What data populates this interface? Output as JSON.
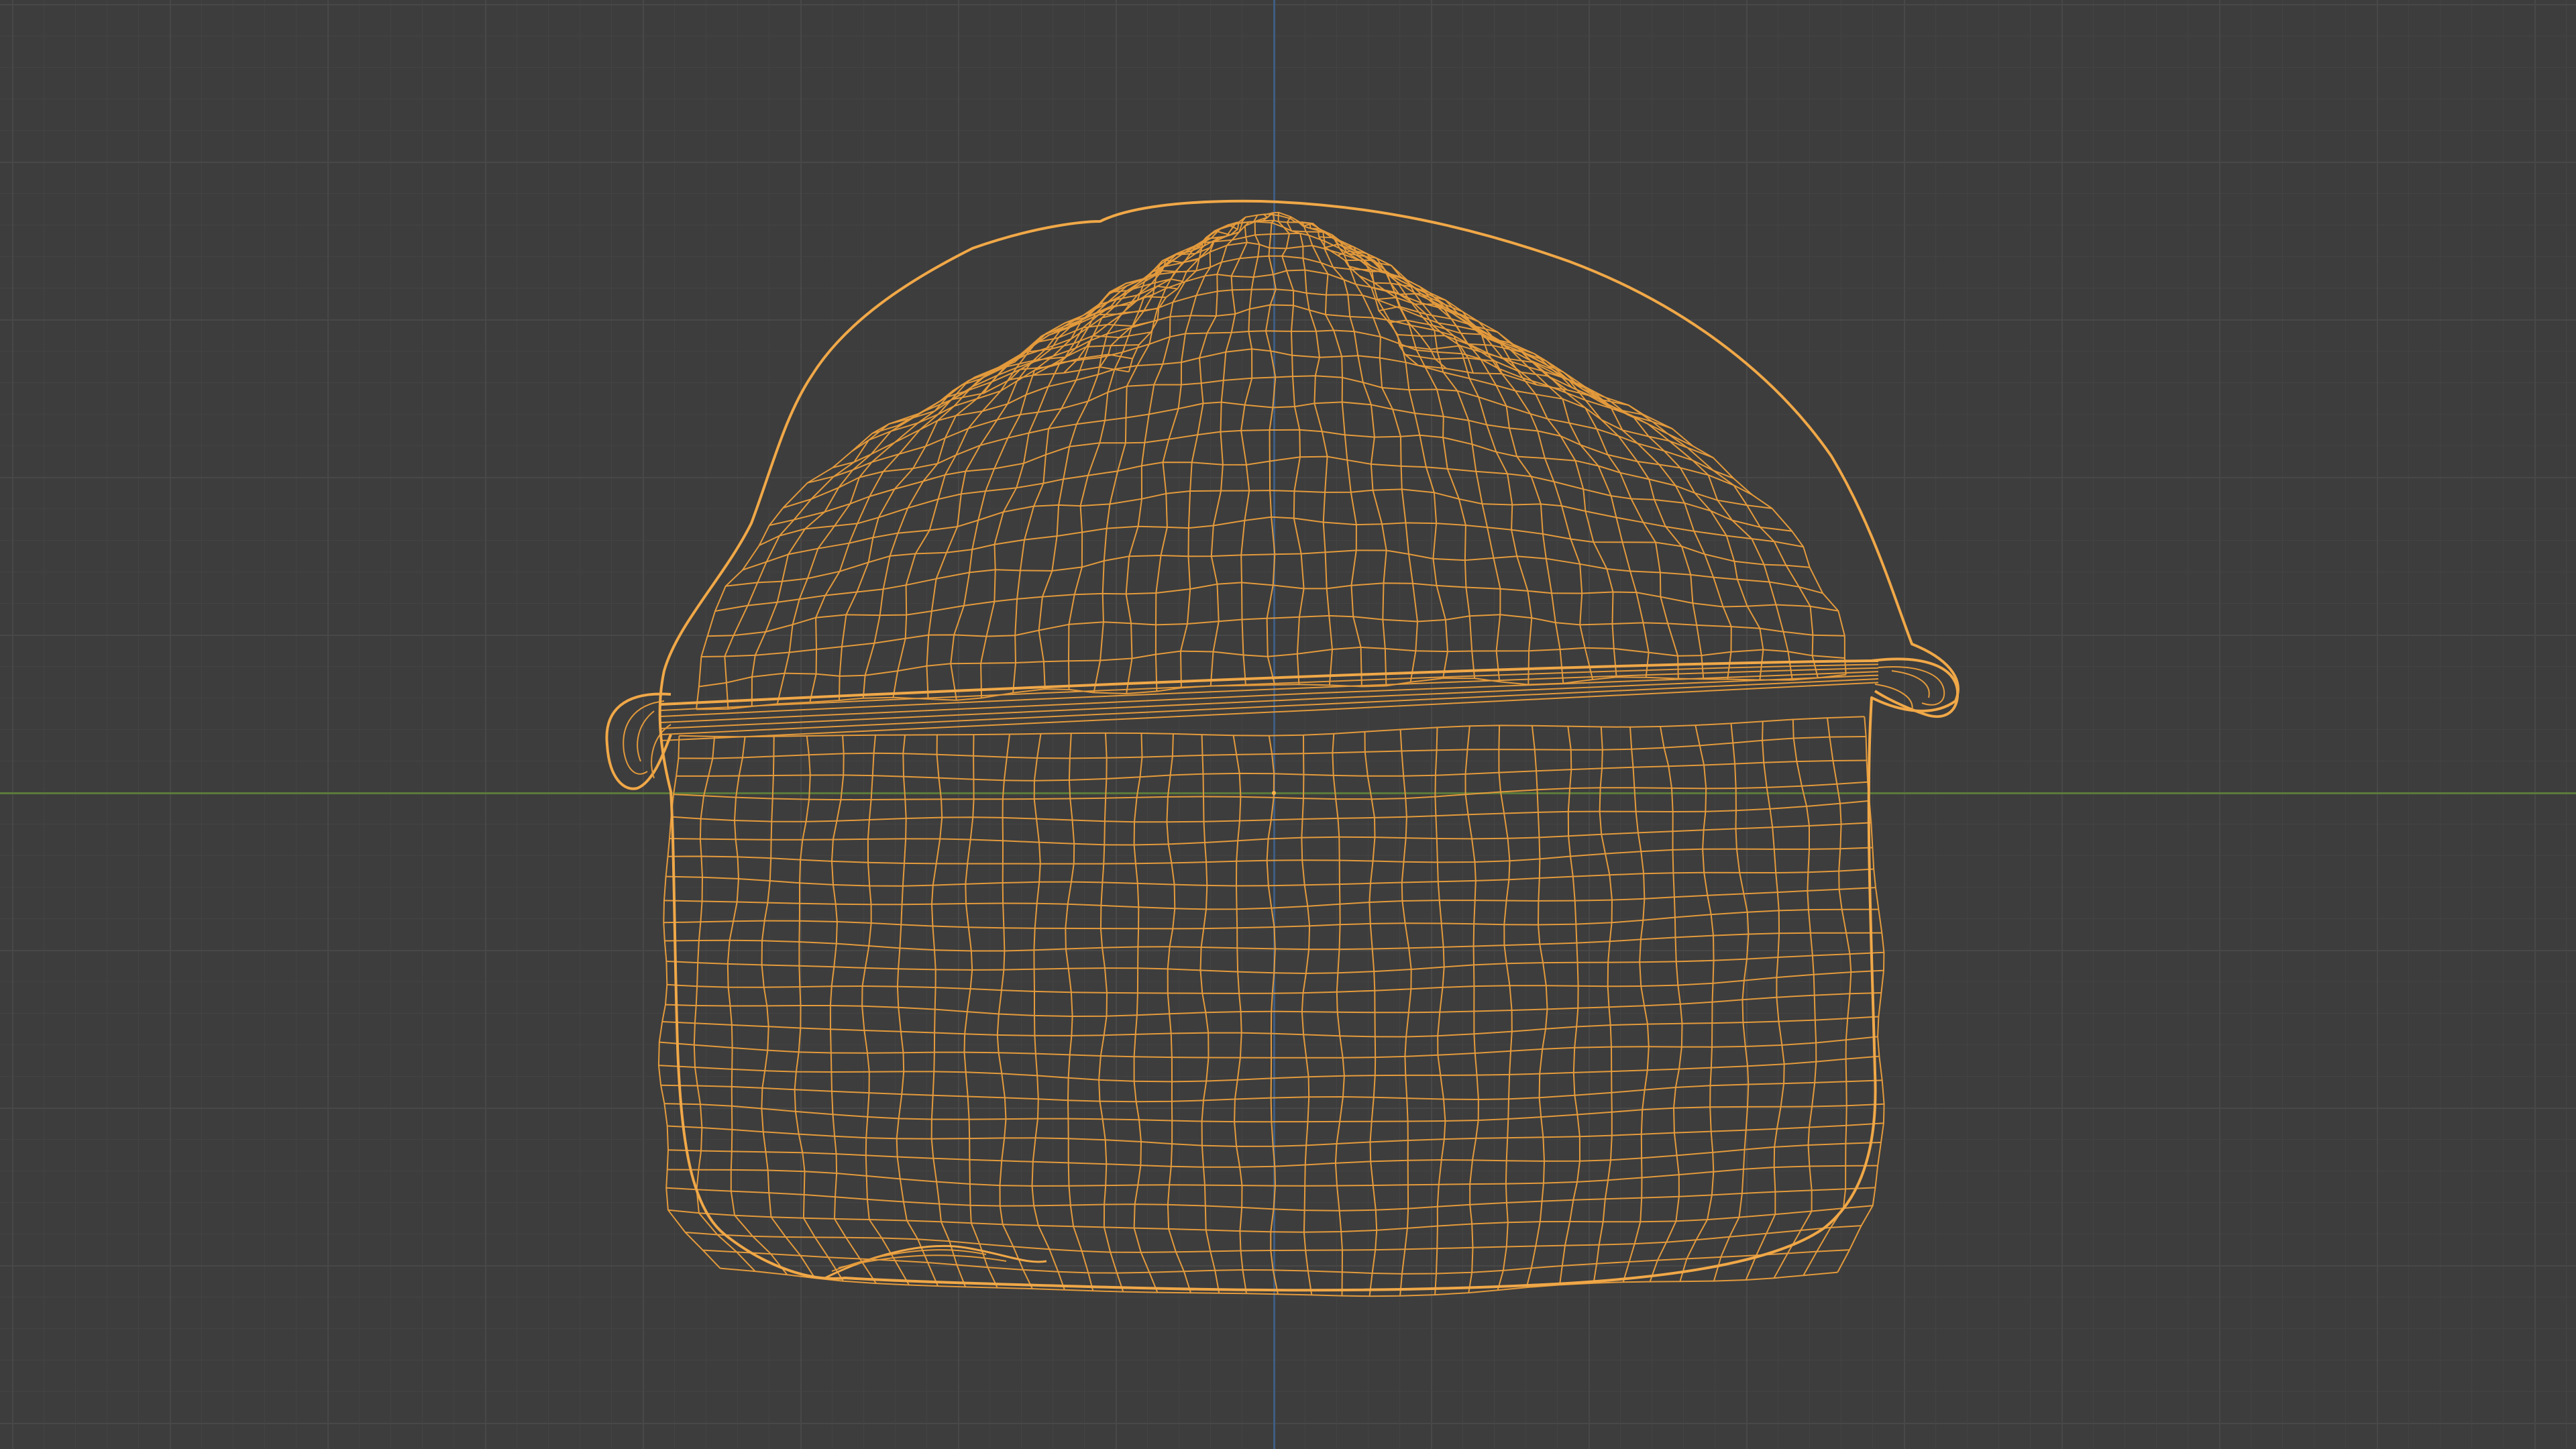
{
  "viewport": {
    "mode": "wireframe",
    "object_shading": "wireframe",
    "selected_object": true
  },
  "colors": {
    "background": "#3d3d3d",
    "grid_minor": "#434343",
    "grid_major": "#484848",
    "axis_x": "#5c7a3a",
    "axis_y": "#3e5d82",
    "wire": "#e39a3c",
    "wire_outline": "#f0a848",
    "origin": "#ffb347"
  }
}
